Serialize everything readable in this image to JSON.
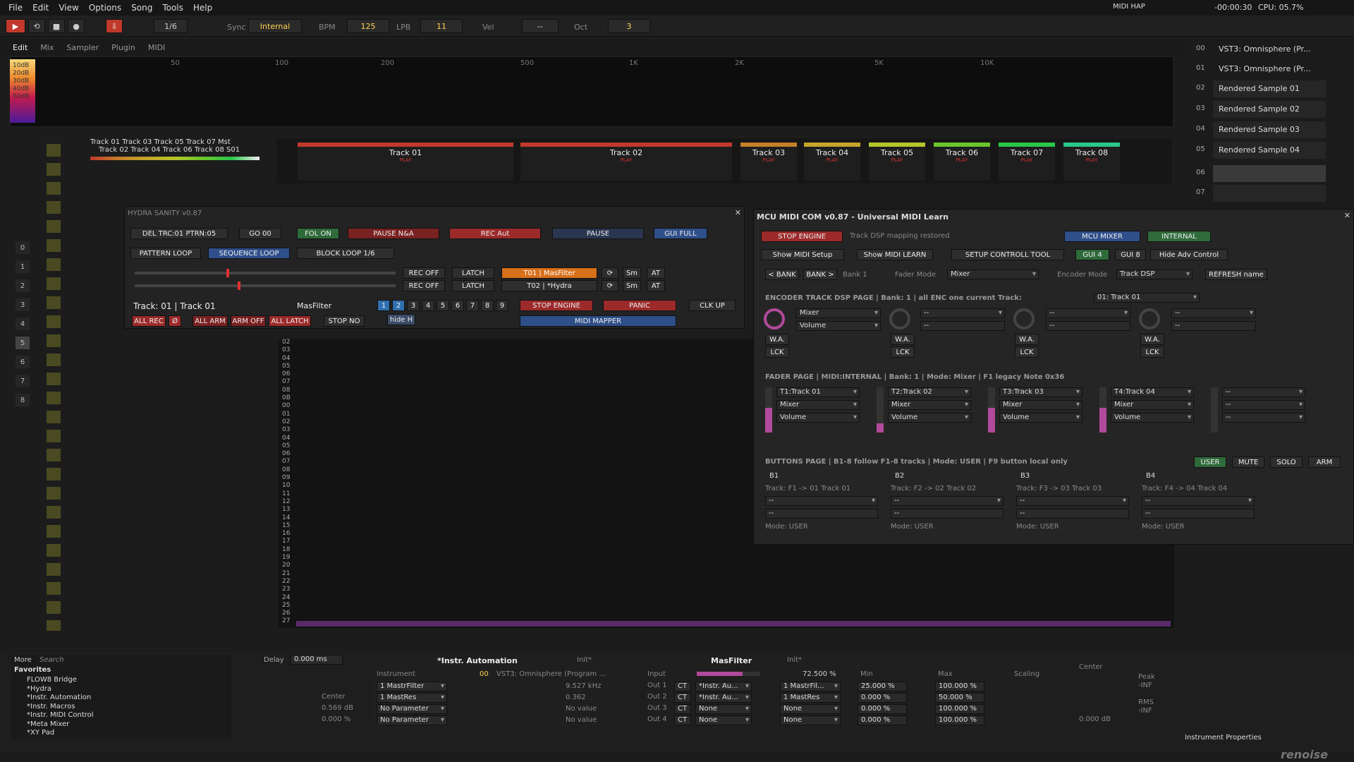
{
  "menu": [
    "File",
    "Edit",
    "View",
    "Options",
    "Song",
    "Tools",
    "Help"
  ],
  "menu_right": {
    "midi": "MIDI HAP",
    "time": "-00:00:30",
    "cpu": "CPU: 05.7%"
  },
  "transport": {
    "pattern_step": "1/6",
    "sync_label": "Sync",
    "sync_value": "Internal",
    "bpm_label": "BPM",
    "bpm": "125",
    "lpb_label": "LPB",
    "lpb": "11",
    "vel_label": "Vel",
    "vel": "--",
    "oct_label": "Oct",
    "oct": "3"
  },
  "view_tabs": [
    "Edit",
    "Mix",
    "Sampler",
    "Plugin",
    "MIDI"
  ],
  "spectrum_labels": [
    "50",
    "100",
    "200",
    "500",
    "1K",
    "2K",
    "5K",
    "10K"
  ],
  "db_labels": [
    "10dB",
    "20dB",
    "30dB",
    "40dB",
    "50dB"
  ],
  "instruments": {
    "items": [
      {
        "num": "00",
        "label": "VST3: Omnisphere (Pr..."
      },
      {
        "num": "01",
        "label": "VST3: Omnisphere (Pr..."
      },
      {
        "num": "02",
        "label": "Rendered Sample 01"
      },
      {
        "num": "03",
        "label": "Rendered Sample 02"
      },
      {
        "num": "04",
        "label": "Rendered Sample 03"
      },
      {
        "num": "05",
        "label": "Rendered Sample 04"
      },
      {
        "num": "06",
        "label": ""
      },
      {
        "num": "07",
        "label": ""
      }
    ]
  },
  "pattern_tracks": [
    {
      "name": "Track 01",
      "color": "#c0392b"
    },
    {
      "name": "Track 02",
      "color": "#c0392b"
    },
    {
      "name": "Track 03",
      "color": "#c67f2a"
    },
    {
      "name": "Track 04",
      "color": "#c6a52a"
    },
    {
      "name": "Track 05",
      "color": "#b6c62a"
    },
    {
      "name": "Track 06",
      "color": "#6ac62a"
    },
    {
      "name": "Track 07",
      "color": "#2ac64a"
    },
    {
      "name": "Track 08",
      "color": "#2ac68a"
    }
  ],
  "mini_tracks": {
    "top": "Track 01  Track 03  Track 05  Track 07  Mst",
    "bottom": "Track 02  Track 04  Track 06  Track 08  S01",
    "play": "PLAY"
  },
  "pattern_lines": [
    "02",
    "03",
    "04",
    "05",
    "06",
    "07",
    "08",
    "0B",
    "00",
    "01",
    "02",
    "03",
    "04",
    "05",
    "06",
    "07",
    "08",
    "09",
    "10",
    "11",
    "12",
    "13",
    "14",
    "15",
    "16",
    "17",
    "18",
    "19",
    "20",
    "21",
    "22",
    "23",
    "24",
    "25",
    "26",
    "27"
  ],
  "hydra": {
    "title": "HYDRA SANITY v0.87",
    "del": "DEL TRC:01 PTRN:05",
    "go": "GO 00",
    "fol": "FOL ON",
    "pause_na": "PAUSE N&A",
    "rec_aut": "REC Aut",
    "pause": "PAUSE",
    "gui_full": "GUI FULL",
    "pattern_loop": "PATTERN LOOP",
    "seq_loop": "SEQUENCE LOOP",
    "block_loop": "BLOCK LOOP 1/6",
    "rec_off": "REC OFF",
    "latch": "LATCH",
    "t01": "T01 | MasFilter",
    "t02": "T02 | *Hydra",
    "sm": "Sm",
    "at": "AT",
    "track": "Track: 01 | Track 01",
    "masfilter": "MasFilter",
    "nums": [
      "1",
      "2",
      "3",
      "4",
      "5",
      "6",
      "7",
      "8",
      "9"
    ],
    "stop_engine": "STOP ENGINE",
    "panic": "PANIC",
    "clk_up": "CLK UP",
    "all_rec": "ALL REC",
    "zero": "Ø",
    "all_arm": "ALL ARM",
    "arm_off": "ARM OFF",
    "all_latch": "ALL LATCH",
    "stop_no": "STOP NO",
    "hide_h": "hide H",
    "midi_mapper": "MIDI MAPPER"
  },
  "mcu": {
    "title": "MCU MIDI COM v0.87 - Universal MIDI Learn",
    "stop_engine": "STOP ENGINE",
    "status": "Track DSP mapping restored",
    "mcu_mixer": "MCU MIXER",
    "internal": "INTERNAL",
    "show_setup": "Show MIDI Setup",
    "show_learn": "Show MIDI LEARN",
    "setup_tool": "SETUP CONTROLL TOOL",
    "gui4": "GUI 4",
    "gui8": "GUI 8",
    "hide_adv": "Hide Adv Control",
    "bank_prev": "< BANK",
    "bank_next": "BANK >",
    "bank": "Bank 1",
    "fader_mode_label": "Fader Mode",
    "fader_mode": "Mixer",
    "encoder_mode_label": "Encoder Mode",
    "encoder_mode": "Track DSP",
    "refresh": "REFRESH name",
    "enc_header": "ENCODER TRACK DSP PAGE | Bank: 1 | all ENC one current Track:",
    "enc_track": "01: Track 01",
    "enc_mixer": "Mixer",
    "enc_volume": "Volume",
    "dash": "--",
    "wa": "W.A.",
    "lck": "LCK",
    "fader_header": "FADER PAGE | MIDI:INTERNAL | Bank: 1 | Mode: Mixer | F1 legacy Note 0x36",
    "faders": [
      {
        "track": "T1:Track 01",
        "dev": "Mixer",
        "param": "Volume",
        "level": 0.55
      },
      {
        "track": "T2:Track 02",
        "dev": "Mixer",
        "param": "Volume",
        "level": 0.2
      },
      {
        "track": "T3:Track 03",
        "dev": "Mixer",
        "param": "Volume",
        "level": 0.55
      },
      {
        "track": "T4:Track 04",
        "dev": "Mixer",
        "param": "Volume",
        "level": 0.55
      },
      {
        "track": "--",
        "dev": "--",
        "param": "--",
        "level": 0
      }
    ],
    "buttons_header": "BUTTONS PAGE | B1-8 follow F1-8 tracks | Mode: USER | F9 button local only",
    "user": "USER",
    "mute": "MUTE",
    "solo": "SOLO",
    "arm": "ARM",
    "bpages": [
      {
        "b": "B1",
        "t": "Track: F1 -> 01 Track 01",
        "mode": "Mode: USER"
      },
      {
        "b": "B2",
        "t": "Track: F2 -> 02 Track 02",
        "mode": "Mode: USER"
      },
      {
        "b": "B3",
        "t": "Track: F3 -> 03 Track 03",
        "mode": "Mode: USER"
      },
      {
        "b": "B4",
        "t": "Track: F4 -> 04 Track 04",
        "mode": "Mode: USER"
      }
    ]
  },
  "browser": {
    "more": "More",
    "search": "Search",
    "favorites": "Favorites",
    "items": [
      "FLOW8 Bridge",
      "*Hydra",
      "*Instr. Automation",
      "*Instr. Macros",
      "*Instr. MIDI Control",
      "*Meta Mixer",
      "*XY Pad"
    ]
  },
  "delay": {
    "label": "Delay",
    "value": "0.000 ms",
    "center": "Center",
    "db": "0.569 dB",
    "pct": "0.000 %"
  },
  "automation": {
    "title": "*Instr. Automation",
    "init": "Init*",
    "instrument": "Instrument",
    "inst_num": "00",
    "inst_name": "VST3: Omnisphere (Program ...",
    "rows": [
      {
        "a": "1 MastrFilter",
        "v": "9.527 kHz"
      },
      {
        "a": "1 MastRes",
        "v": "0.362"
      },
      {
        "a": "No Parameter",
        "v": "No value"
      },
      {
        "a": "No Parameter",
        "v": "No value"
      }
    ]
  },
  "masfilter": {
    "title": "MasFilter",
    "init": "Init*",
    "input": "Input",
    "input_val": "72.500 %",
    "min": "Min",
    "max": "Max",
    "scaling": "Scaling",
    "outs": [
      {
        "o": "Out 1",
        "ct": "CT",
        "dev": "*Instr. Au...",
        "p": "1 MastrFil...",
        "min": "25.000 %",
        "max": "100.000 %"
      },
      {
        "o": "Out 2",
        "ct": "CT",
        "dev": "*Instr. Au...",
        "p": "1 MastRes",
        "min": "0.000 %",
        "max": "50.000 %"
      },
      {
        "o": "Out 3",
        "ct": "CT",
        "dev": "None",
        "p": "None",
        "min": "0.000 %",
        "max": "100.000 %"
      },
      {
        "o": "Out 4",
        "ct": "CT",
        "dev": "None",
        "p": "None",
        "min": "0.000 %",
        "max": "100.000 %"
      }
    ]
  },
  "meter": {
    "center": "Center",
    "db": "0.000 dB",
    "peak": "Peak",
    "inf": "-INF",
    "rms": "RMS"
  },
  "props": "Instrument Properties",
  "logo": "renoise"
}
